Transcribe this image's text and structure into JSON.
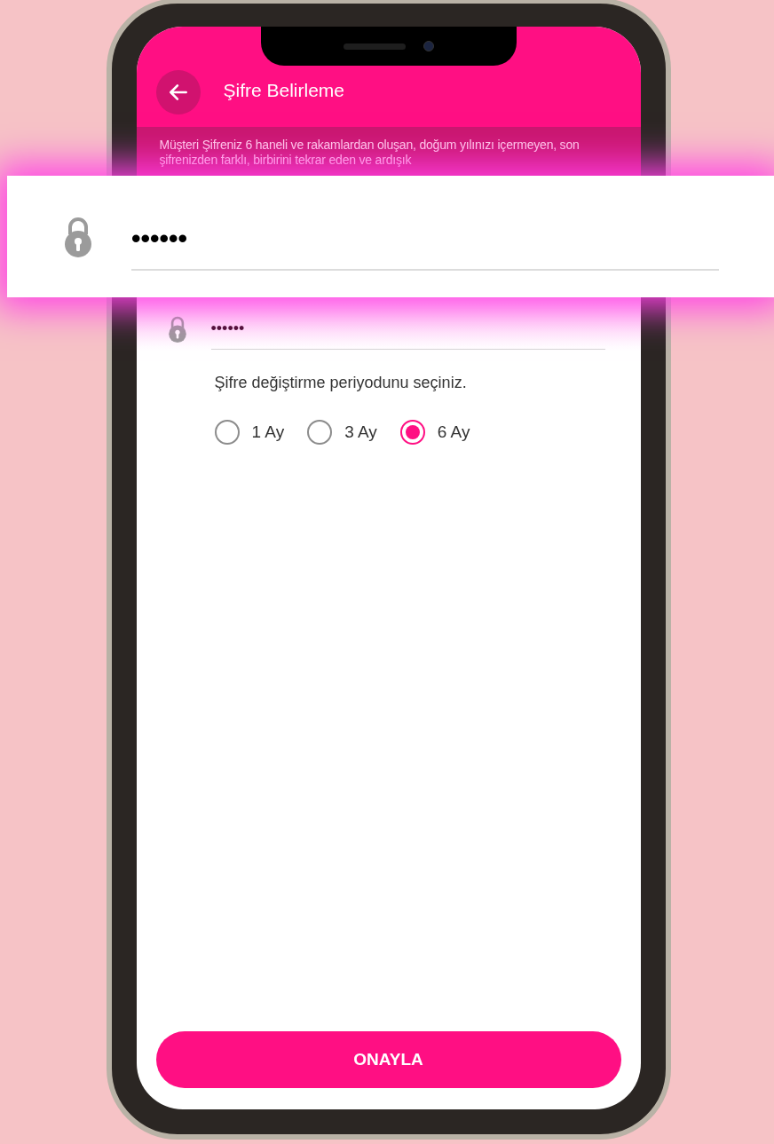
{
  "header": {
    "title": "Şifre Belirleme"
  },
  "info": {
    "text": "Müşteri Şifreniz 6 haneli ve rakamlardan oluşan, doğum yılınızı içermeyen, son şifrenizden farklı, birbirini tekrar eden ve ardışık"
  },
  "zoomed_field": {
    "value": "••••••"
  },
  "confirm_field": {
    "value": "••••••"
  },
  "period": {
    "label": "Şifre değiştirme periyodunu seçiniz.",
    "options": [
      {
        "label": "1 Ay",
        "selected": false
      },
      {
        "label": "3 Ay",
        "selected": false
      },
      {
        "label": "6 Ay",
        "selected": true
      }
    ]
  },
  "button": {
    "label": "ONAYLA"
  }
}
